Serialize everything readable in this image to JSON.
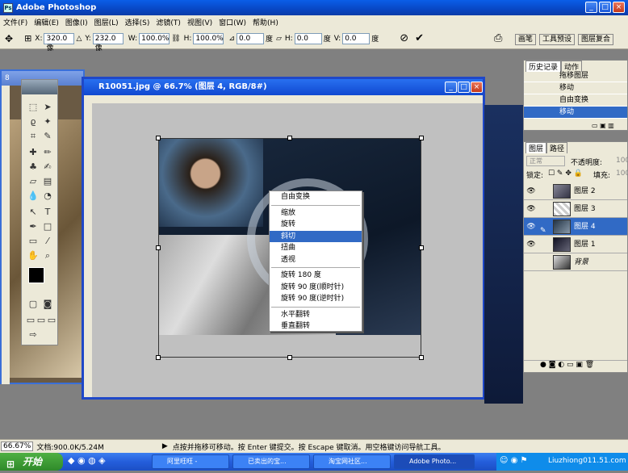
{
  "app": {
    "title": "Adobe Photoshop"
  },
  "menu": [
    "文件(F)",
    "编辑(E)",
    "图像(I)",
    "图层(L)",
    "选择(S)",
    "滤镜(T)",
    "视图(V)",
    "窗口(W)",
    "帮助(H)"
  ],
  "options": {
    "x_label": "X:",
    "x_value": "320.0 像",
    "y_label": "Y:",
    "y_value": "232.0 像",
    "w_label": "W:",
    "w_value": "100.0%",
    "h_label": "H:",
    "h_value": "100.0%",
    "angle_value": "0.0",
    "angle_unit": "度",
    "hskew_label": "H:",
    "hskew_value": "0.0",
    "hskew_unit": "度",
    "vskew_label": "V:",
    "vskew_value": "0.0",
    "vskew_unit": "度",
    "tab_brushes": "画笔",
    "tab_presets": "工具预设",
    "tab_comps": "图层复合"
  },
  "bg_doc": {
    "title": "8"
  },
  "document": {
    "title": "R10051.jpg @ 66.7% (图层 4, RGB/8#)"
  },
  "context_menu": {
    "groups": [
      [
        "自由变换"
      ],
      [
        "缩放",
        "旋转",
        "斜切",
        "扭曲",
        "透视"
      ],
      [
        "旋转 180 度",
        "旋转 90 度(顺时针)",
        "旋转 90 度(逆时针)"
      ],
      [
        "水平翻转",
        "垂直翻转"
      ]
    ],
    "selected": "斜切"
  },
  "history": {
    "tabs": [
      "历史记录",
      "动作"
    ],
    "items": [
      "拖移图层",
      "移动",
      "自由变换",
      "移动"
    ],
    "selected_index": 3
  },
  "layers": {
    "tabs": [
      "图层",
      "路径"
    ],
    "blend_mode": "正常",
    "opacity_label": "不透明度:",
    "opacity_value": "100",
    "lock_label": "锁定:",
    "fill_label": "填充:",
    "fill_value": "100",
    "items": [
      "图层 2",
      "图层 3",
      "图层 4",
      "图层 1",
      "背景"
    ],
    "selected": "图层 4"
  },
  "status": {
    "zoom": "66.67%",
    "doc": "文档:900.0K/5.24M",
    "hint": "点按并拖移可移动。按 Enter 键提交。按 Escape 键取消。用空格键访问导航工具。"
  },
  "taskbar": {
    "start": "开始",
    "items": [
      "阿里旺旺 -",
      "已卖出的宝...",
      "淘宝网社区...",
      "Adobe Photo..."
    ],
    "active_index": 3,
    "watermark": "Liuzhiong011.51.com"
  },
  "colors": {
    "accent": "#316ac5",
    "titlebar": "#0a5ee8",
    "taskbar": "#245edb",
    "start": "#3c9a34"
  }
}
